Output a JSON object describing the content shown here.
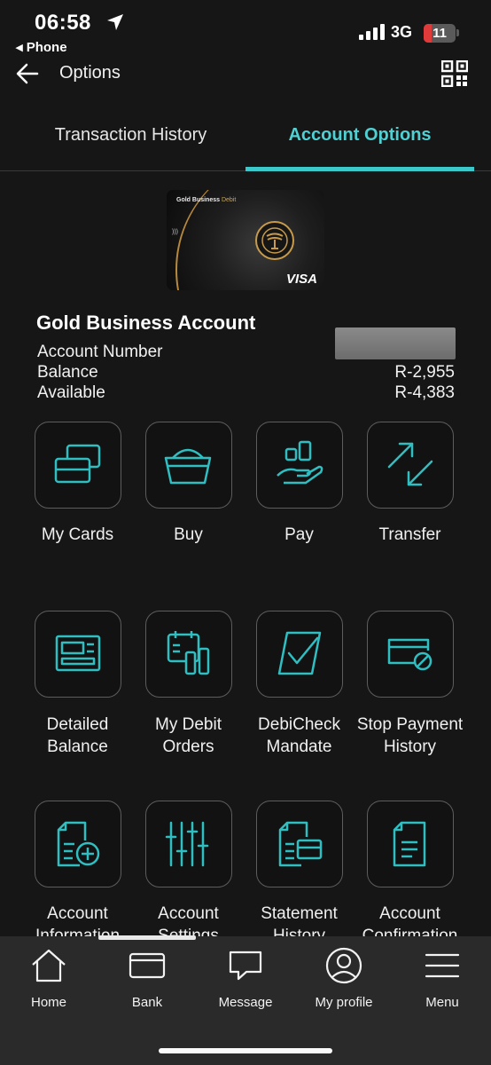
{
  "status_bar": {
    "time": "06:58",
    "back_app": "◂ Phone",
    "network": "3G",
    "battery": "11"
  },
  "header": {
    "title": "Options",
    "back_icon": "arrow-left-icon",
    "qr_icon": "qr-code-icon"
  },
  "tabs": [
    {
      "label": "Transaction History",
      "active": false
    },
    {
      "label": "Account Options",
      "active": true
    }
  ],
  "card": {
    "brand": "Gold Business",
    "brand_suffix": "Debit",
    "network": "VISA"
  },
  "account": {
    "name": "Gold Business Account",
    "number_label": "Account Number",
    "balance_label": "Balance",
    "balance_value": "R-2,955",
    "available_label": "Available",
    "available_value": "R-4,383"
  },
  "options": [
    {
      "label": "My Cards",
      "icon": "cards-icon"
    },
    {
      "label": "Buy",
      "icon": "basket-icon"
    },
    {
      "label": "Pay",
      "icon": "hand-pay-icon"
    },
    {
      "label": "Transfer",
      "icon": "transfer-arrows-icon"
    },
    {
      "label": "Detailed\nBalance",
      "icon": "balance-document-icon"
    },
    {
      "label": "My Debit\nOrders",
      "icon": "debit-orders-icon"
    },
    {
      "label": "DebiCheck\nMandate",
      "icon": "check-mandate-icon"
    },
    {
      "label": "Stop Payment\nHistory",
      "icon": "stop-payment-icon"
    },
    {
      "label": "Account\nInformation",
      "icon": "document-plus-icon"
    },
    {
      "label": "Account\nSettings",
      "icon": "sliders-icon"
    },
    {
      "label": "Statement\nHistory",
      "icon": "statement-icon"
    },
    {
      "label": "Account\nConfirmation",
      "icon": "document-lines-icon"
    }
  ],
  "bottom_nav": [
    {
      "label": "Home",
      "icon": "home-icon"
    },
    {
      "label": "Bank",
      "icon": "bank-card-icon"
    },
    {
      "label": "Message",
      "icon": "speech-bubble-icon"
    },
    {
      "label": "My profile",
      "icon": "profile-icon"
    },
    {
      "label": "Menu",
      "icon": "hamburger-menu-icon"
    }
  ],
  "colors": {
    "accent": "#3cc8cb",
    "background": "#161616",
    "nav_background": "#2a2a2a",
    "card_gold": "#c79b4a"
  }
}
